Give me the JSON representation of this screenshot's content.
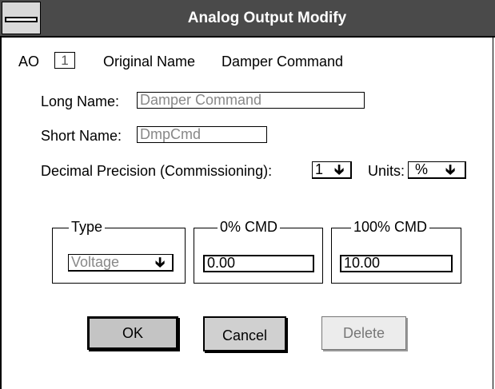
{
  "window": {
    "title": "Analog Output Modify"
  },
  "ao": {
    "label": "AO",
    "number": "1",
    "original_name_label": "Original Name",
    "original_name_value": "Damper Command"
  },
  "long_name": {
    "label": "Long Name:",
    "value": "Damper Command"
  },
  "short_name": {
    "label": "Short Name:",
    "value": "DmpCmd"
  },
  "decimal_precision": {
    "label": "Decimal Precision (Commissioning):",
    "value": "1"
  },
  "units": {
    "label": "Units:",
    "value": "%"
  },
  "type_group": {
    "label": "Type",
    "value": "Voltage"
  },
  "cmd0_group": {
    "label": "0% CMD",
    "value": "0.00"
  },
  "cmd100_group": {
    "label": "100% CMD",
    "value": "10.00"
  },
  "buttons": {
    "ok": "OK",
    "cancel": "Cancel",
    "delete": "Delete"
  },
  "icons": {
    "system_menu": "system-menu-icon",
    "dropdown_arrow": "down-arrow-icon"
  }
}
